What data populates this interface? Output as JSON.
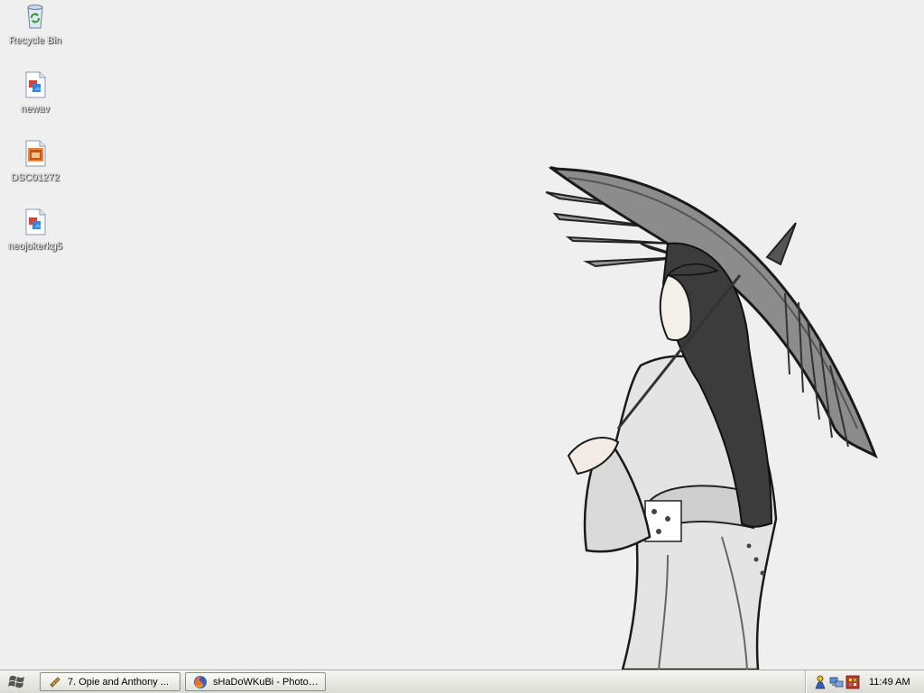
{
  "desktop": {
    "icons": [
      {
        "label": "Recycle Bin",
        "icon": "recycle-bin-icon"
      },
      {
        "label": "newav",
        "icon": "image-file-icon"
      },
      {
        "label": "DSC01272",
        "icon": "photo-file-icon"
      },
      {
        "label": "neojokerkg5",
        "icon": "image-file-icon"
      }
    ],
    "wallpaper": "woman-with-umbrella-illustration"
  },
  "taskbar": {
    "start_icon": "windows-logo-icon",
    "tasks": [
      {
        "label": "7. Opie and Anthony ...",
        "icon": "media-player-icon"
      },
      {
        "label": "sHaDoWKuBi - Photob...",
        "icon": "firefox-icon"
      }
    ],
    "tray": {
      "icons": [
        "messenger-icon",
        "network-icon",
        "app-tray-icon"
      ],
      "clock": "11:49 AM"
    }
  },
  "colors": {
    "desktop_bg": "#efefef",
    "taskbar_bg": "#e8e8e2",
    "icon_label": "#ffffff"
  }
}
